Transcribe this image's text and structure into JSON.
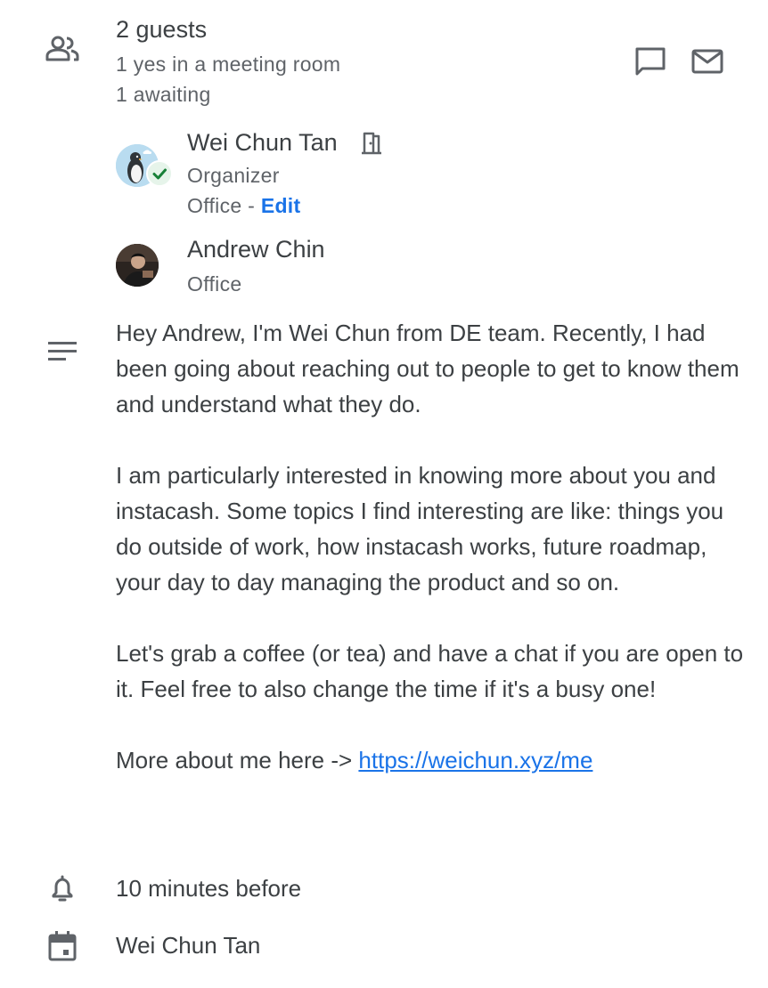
{
  "guests": {
    "title": "2 guests",
    "summary_yes": "1 yes in a meeting room",
    "summary_awaiting": "1 awaiting",
    "icon": "people-icon",
    "actions": [
      {
        "icon": "chat-icon"
      },
      {
        "icon": "email-icon"
      }
    ],
    "list": [
      {
        "name": "Wei Chun Tan",
        "role": "Organizer",
        "location": "Office",
        "separator": " - ",
        "edit_label": "Edit",
        "status": "accepted",
        "badge_icon": "check-icon",
        "room_icon": "meeting-room-icon",
        "avatar": "penguin-avatar"
      },
      {
        "name": "Andrew Chin",
        "location": "Office",
        "avatar": "photo-avatar"
      }
    ]
  },
  "description": {
    "icon": "notes-icon",
    "paragraphs": [
      "Hey Andrew, I'm Wei Chun from DE team. Recently, I had been going about reaching out to people to get to know them and understand what they do.",
      "I am particularly interested in knowing more about you and instacash. Some topics I find interesting are like: things you do outside of work, how instacash works, future roadmap, your day to day managing the product and so on.",
      "Let's grab a coffee (or tea) and have a chat if you are open to it. Feel free to also change the time if it's a busy one!"
    ],
    "more_prefix": "More about me here -> ",
    "more_link": "https://weichun.xyz/me"
  },
  "reminder": {
    "icon": "bell-icon",
    "text": "10 minutes before"
  },
  "calendar": {
    "icon": "calendar-icon",
    "text": "Wei Chun Tan"
  },
  "colors": {
    "text": "#3c4043",
    "secondary": "#5f6368",
    "accent": "#1a73e8",
    "success": "#188038"
  }
}
